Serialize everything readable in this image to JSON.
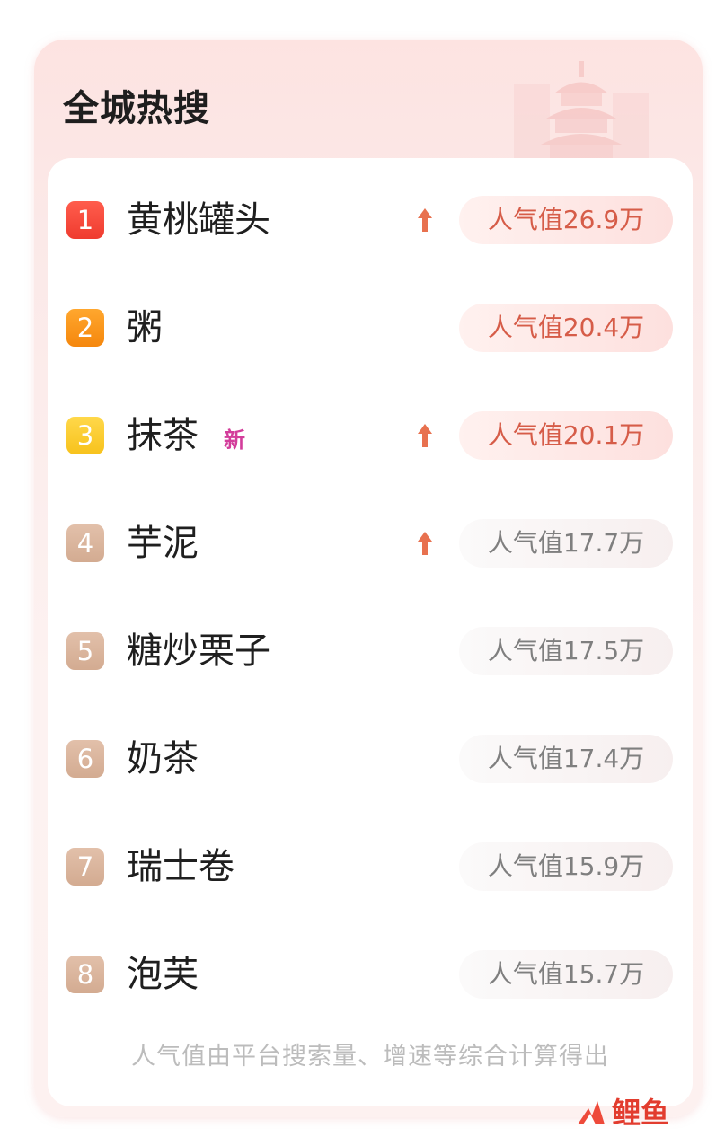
{
  "header": {
    "title": "全城热搜"
  },
  "list": [
    {
      "rank": "1",
      "term": "黄桃罐头",
      "badge": "",
      "trend": "up",
      "heat": "人气值26.9万"
    },
    {
      "rank": "2",
      "term": "粥",
      "badge": "",
      "trend": "",
      "heat": "人气值20.4万"
    },
    {
      "rank": "3",
      "term": "抹茶",
      "badge": "新",
      "trend": "up",
      "heat": "人气值20.1万"
    },
    {
      "rank": "4",
      "term": "芋泥",
      "badge": "",
      "trend": "up",
      "heat": "人气值17.7万"
    },
    {
      "rank": "5",
      "term": "糖炒栗子",
      "badge": "",
      "trend": "",
      "heat": "人气值17.5万"
    },
    {
      "rank": "6",
      "term": "奶茶",
      "badge": "",
      "trend": "",
      "heat": "人气值17.4万"
    },
    {
      "rank": "7",
      "term": "瑞士卷",
      "badge": "",
      "trend": "",
      "heat": "人气值15.9万"
    },
    {
      "rank": "8",
      "term": "泡芙",
      "badge": "",
      "trend": "",
      "heat": "人气值15.7万"
    }
  ],
  "footer": {
    "note": "人气值由平台搜索量、增速等综合计算得出"
  },
  "watermark": {
    "text": "鲤鱼"
  },
  "colors": {
    "rank_top1": "#ef3b2f",
    "rank_top2": "#f5870d",
    "rank_top3": "#f7c21c",
    "rank_other": "#d3ab91",
    "trend_up": "#e8714f",
    "badge_new": "#d33d9b"
  },
  "icons": {
    "trend_up": "arrow-up-icon",
    "watermark": "fire-logo-icon",
    "decoration": "temple-icon"
  }
}
